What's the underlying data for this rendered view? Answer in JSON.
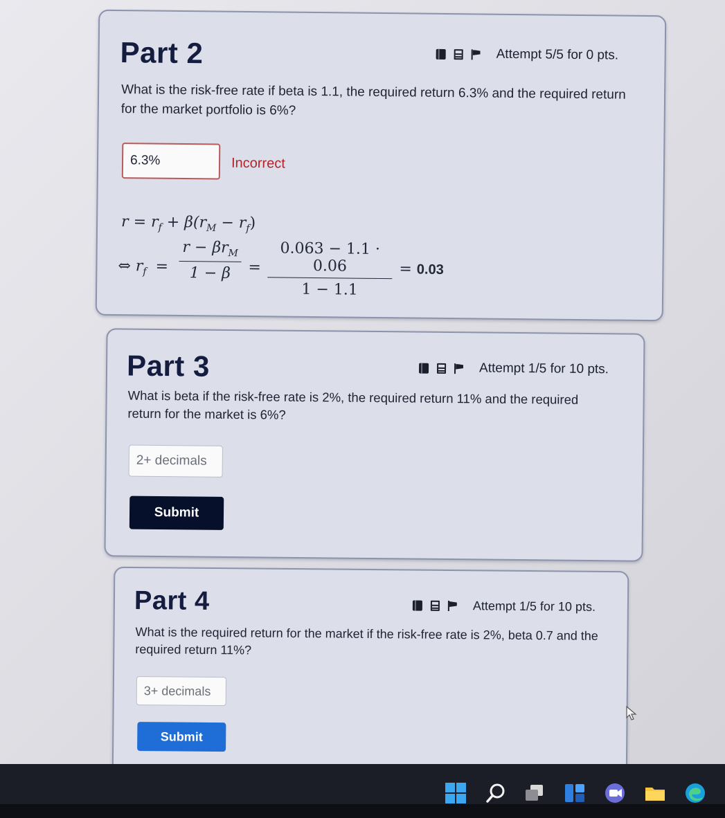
{
  "part2": {
    "title": "Part 2",
    "attempt": "Attempt 5/5 for 0 pts.",
    "question": "What is the risk-free rate if beta is 1.1, the required return 6.3% and the required return for the market portfolio is 6%?",
    "answer_value": "6.3%",
    "status": "Incorrect",
    "solution": {
      "line1_lhs": "r",
      "line1_eq": "=",
      "line1_rhs_a": "r",
      "line1_rhs_a_sub": "f",
      "line1_plus": "+ β(",
      "line1_rm": "r",
      "line1_rm_sub": "M",
      "line1_minus": "− r",
      "line1_rf_sub": "f",
      "line1_close": ")",
      "line2_prefix": "⇔ r",
      "line2_prefix_sub": "f",
      "line2_eq1": "=",
      "frac1_num": "r − βr",
      "frac1_num_sub": "M",
      "frac1_den": "1 − β",
      "line2_eq2": "=",
      "frac2_num": "0.063 − 1.1 · 0.06",
      "frac2_den": "1 − 1.1",
      "line2_eq3": "=",
      "result": "0.03"
    }
  },
  "part3": {
    "title": "Part 3",
    "attempt": "Attempt 1/5 for 10 pts.",
    "question": "What is beta if the risk-free rate is 2%, the required return 11% and the required return for the market is 6%?",
    "placeholder": "2+ decimals",
    "submit_label": "Submit"
  },
  "part4": {
    "title": "Part 4",
    "attempt": "Attempt 1/5 for 10 pts.",
    "question": "What is the required return for the market if the risk-free rate is 2%, beta 0.7 and the required return 11%?",
    "placeholder": "3+ decimals",
    "submit_label": "Submit"
  },
  "icons": {
    "toolbar": [
      "book-icon",
      "film-icon",
      "flag-icon"
    ],
    "taskbar": [
      "windows-start-icon",
      "search-icon",
      "task-view-icon",
      "widgets-icon",
      "teams-chat-icon",
      "file-explorer-icon",
      "edge-browser-icon"
    ]
  },
  "colors": {
    "card_bg": "#dcdfe9",
    "title": "#141c40",
    "incorrect": "#b0242a",
    "submit_dark": "#06102a",
    "submit_blue": "#1f6ed8"
  }
}
